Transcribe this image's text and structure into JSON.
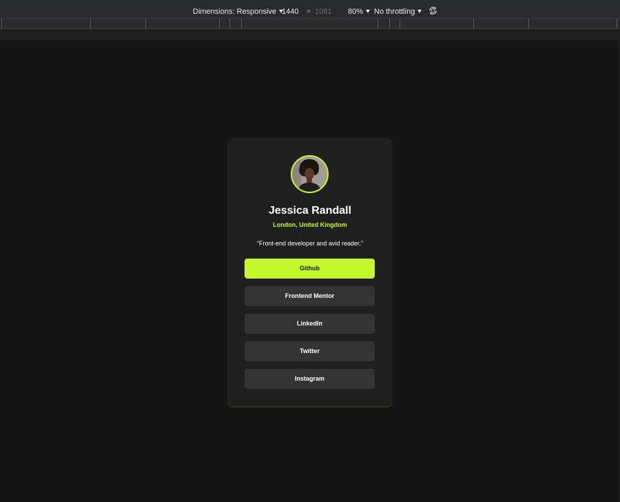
{
  "devtools": {
    "dimensions_label": "Dimensions: Responsive",
    "width": "1440",
    "times": "×",
    "height": "1081",
    "zoom": "80%",
    "throttling": "No throttling",
    "rotate_icon": "rotate-icon"
  },
  "profile": {
    "name": "Jessica Randall",
    "location": "London, United Kingdom",
    "bio": "“Front-end developer and avid reader.”",
    "accent_color": "#c4f82a",
    "links": [
      {
        "label": "Github",
        "active": true
      },
      {
        "label": "Frontend Mentor",
        "active": false
      },
      {
        "label": "LinkedIn",
        "active": false
      },
      {
        "label": "Twitter",
        "active": false
      },
      {
        "label": "Instagram",
        "active": false
      }
    ]
  }
}
